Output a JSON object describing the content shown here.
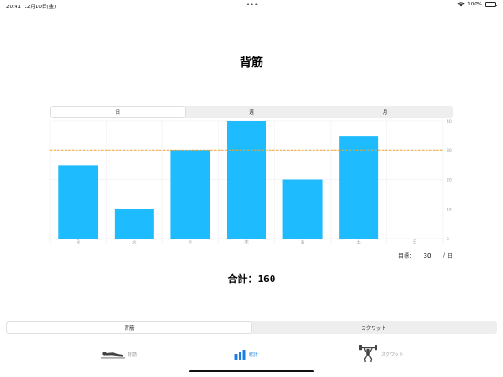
{
  "status_bar": {
    "time": "20:41",
    "date": "12月10日(金)",
    "dots": "•••",
    "battery": "100%"
  },
  "page": {
    "title": "背筋"
  },
  "period_tabs": [
    {
      "label": "日",
      "selected": true
    },
    {
      "label": "週",
      "selected": false
    },
    {
      "label": "月",
      "selected": false
    }
  ],
  "chart_data": {
    "type": "bar",
    "categories": [
      "月",
      "火",
      "水",
      "木",
      "金",
      "土",
      "日"
    ],
    "values": [
      25,
      10,
      30,
      40,
      20,
      35,
      0
    ],
    "ylim": [
      0,
      40
    ],
    "yticks": [
      "0",
      "10",
      "20",
      "30",
      "40"
    ],
    "goal_line": 30,
    "grid": true,
    "bar_color": "#1ebcff",
    "goal_color": "#f4a128"
  },
  "goal": {
    "label": "目標：",
    "value": "30",
    "separator": "/",
    "unit": "日"
  },
  "total": {
    "label": "合計：",
    "value": "160"
  },
  "exercise_tabs": [
    {
      "label": "背筋",
      "selected": true
    },
    {
      "label": "スクワット",
      "selected": false
    }
  ],
  "tab_bar": [
    {
      "label": "背筋",
      "icon": "person-lying-icon",
      "active": false
    },
    {
      "label": "統計",
      "icon": "bar-chart-icon",
      "active": true
    },
    {
      "label": "スクワット",
      "icon": "weightlifter-icon",
      "active": false
    }
  ],
  "colors": {
    "accent": "#1a7fe0"
  }
}
